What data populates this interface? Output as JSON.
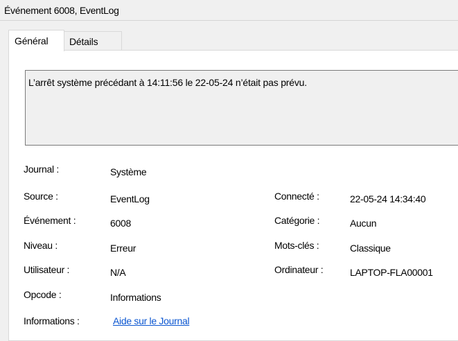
{
  "window": {
    "title": "Événement 6008, EventLog"
  },
  "tabs": [
    {
      "label": "Général",
      "active": true
    },
    {
      "label": "Détails",
      "active": false
    }
  ],
  "description": "L’arrêt système précédant à 14:11:56 le 22-05-24 n’était pas prévu.",
  "properties": {
    "journal": {
      "label": "Journal :",
      "value": "Système"
    },
    "source": {
      "label": "Source :",
      "value": "EventLog"
    },
    "evenement": {
      "label": "Événement :",
      "value": "6008"
    },
    "niveau": {
      "label": "Niveau :",
      "value": "Erreur"
    },
    "utilisateur": {
      "label": "Utilisateur :",
      "value": "N/A"
    },
    "opcode": {
      "label": "Opcode :",
      "value": "Informations"
    },
    "informations": {
      "label": "Informations :",
      "value": "Aide sur le Journal"
    },
    "connecte": {
      "label": "Connecté :",
      "value": "22-05-24 14:34:40"
    },
    "categorie": {
      "label": "Catégorie :",
      "value": "Aucun"
    },
    "motscles": {
      "label": "Mots-clés :",
      "value": "Classique"
    },
    "ordinateur": {
      "label": "Ordinateur :",
      "value": "LAPTOP-FLA00001"
    }
  },
  "colors": {
    "link": "#0a55d0",
    "panel": "#ffffff",
    "chrome": "#f0f0f0"
  }
}
